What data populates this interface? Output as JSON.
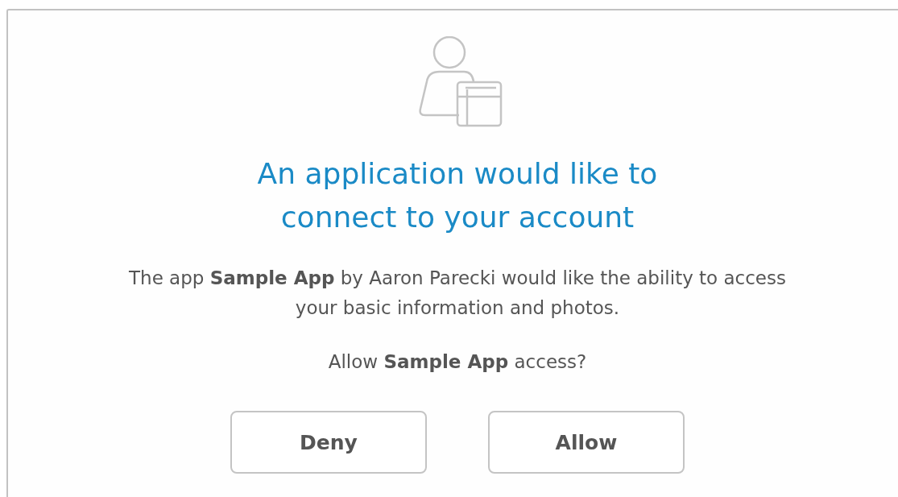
{
  "title": "An application would like to connect to your account",
  "description": "The app **Sample App** by Aaron Parecki would like the ability to access your basic information and photos.",
  "question": "Allow **Sample App** access?",
  "buttons": [
    "Deny",
    "Allow"
  ]
}
